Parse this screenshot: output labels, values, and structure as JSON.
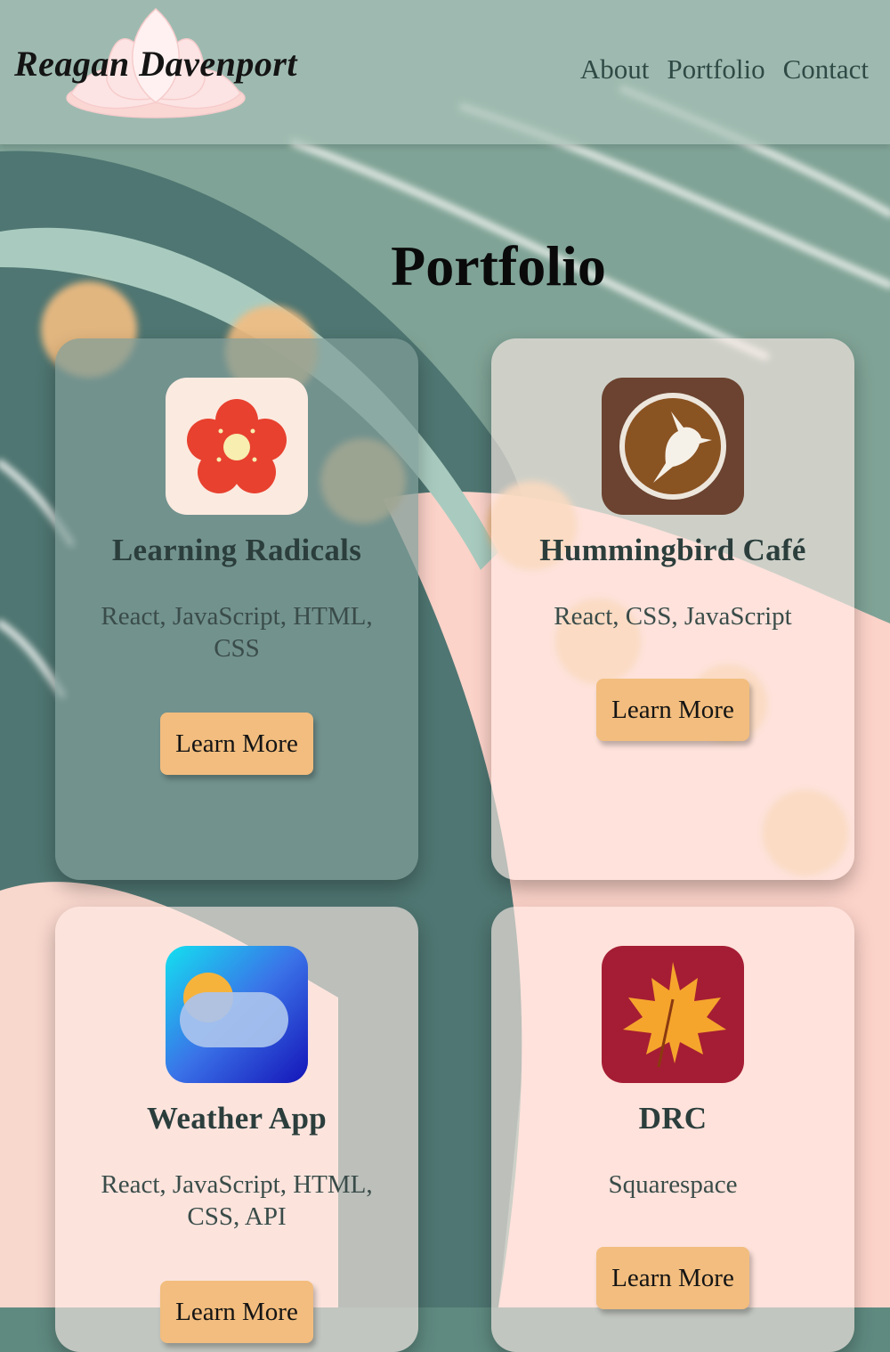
{
  "header": {
    "brand": "Reagan Davenport",
    "nav": [
      "About",
      "Portfolio",
      "Contact"
    ]
  },
  "page_title": "Portfolio",
  "projects": [
    {
      "title": "Learning Radicals",
      "tech": "React, JavaScript, HTML, CSS",
      "button": "Learn More",
      "icon": "red-flower-icon"
    },
    {
      "title": "Hummingbird Café",
      "tech": "React, CSS, JavaScript",
      "button": "Learn More",
      "icon": "hummingbird-icon"
    },
    {
      "title": "Weather App",
      "tech": "React, JavaScript, HTML, CSS, API",
      "button": "Learn More",
      "icon": "weather-cloud-icon"
    },
    {
      "title": "DRC",
      "tech": "Squarespace",
      "button": "Learn More",
      "icon": "maple-leaf-icon"
    }
  ],
  "colors": {
    "accent_button": "#f2bd7e",
    "header_bg": "#aac4ba",
    "teal": "#5f8a80",
    "pink": "#ffd9cf"
  }
}
